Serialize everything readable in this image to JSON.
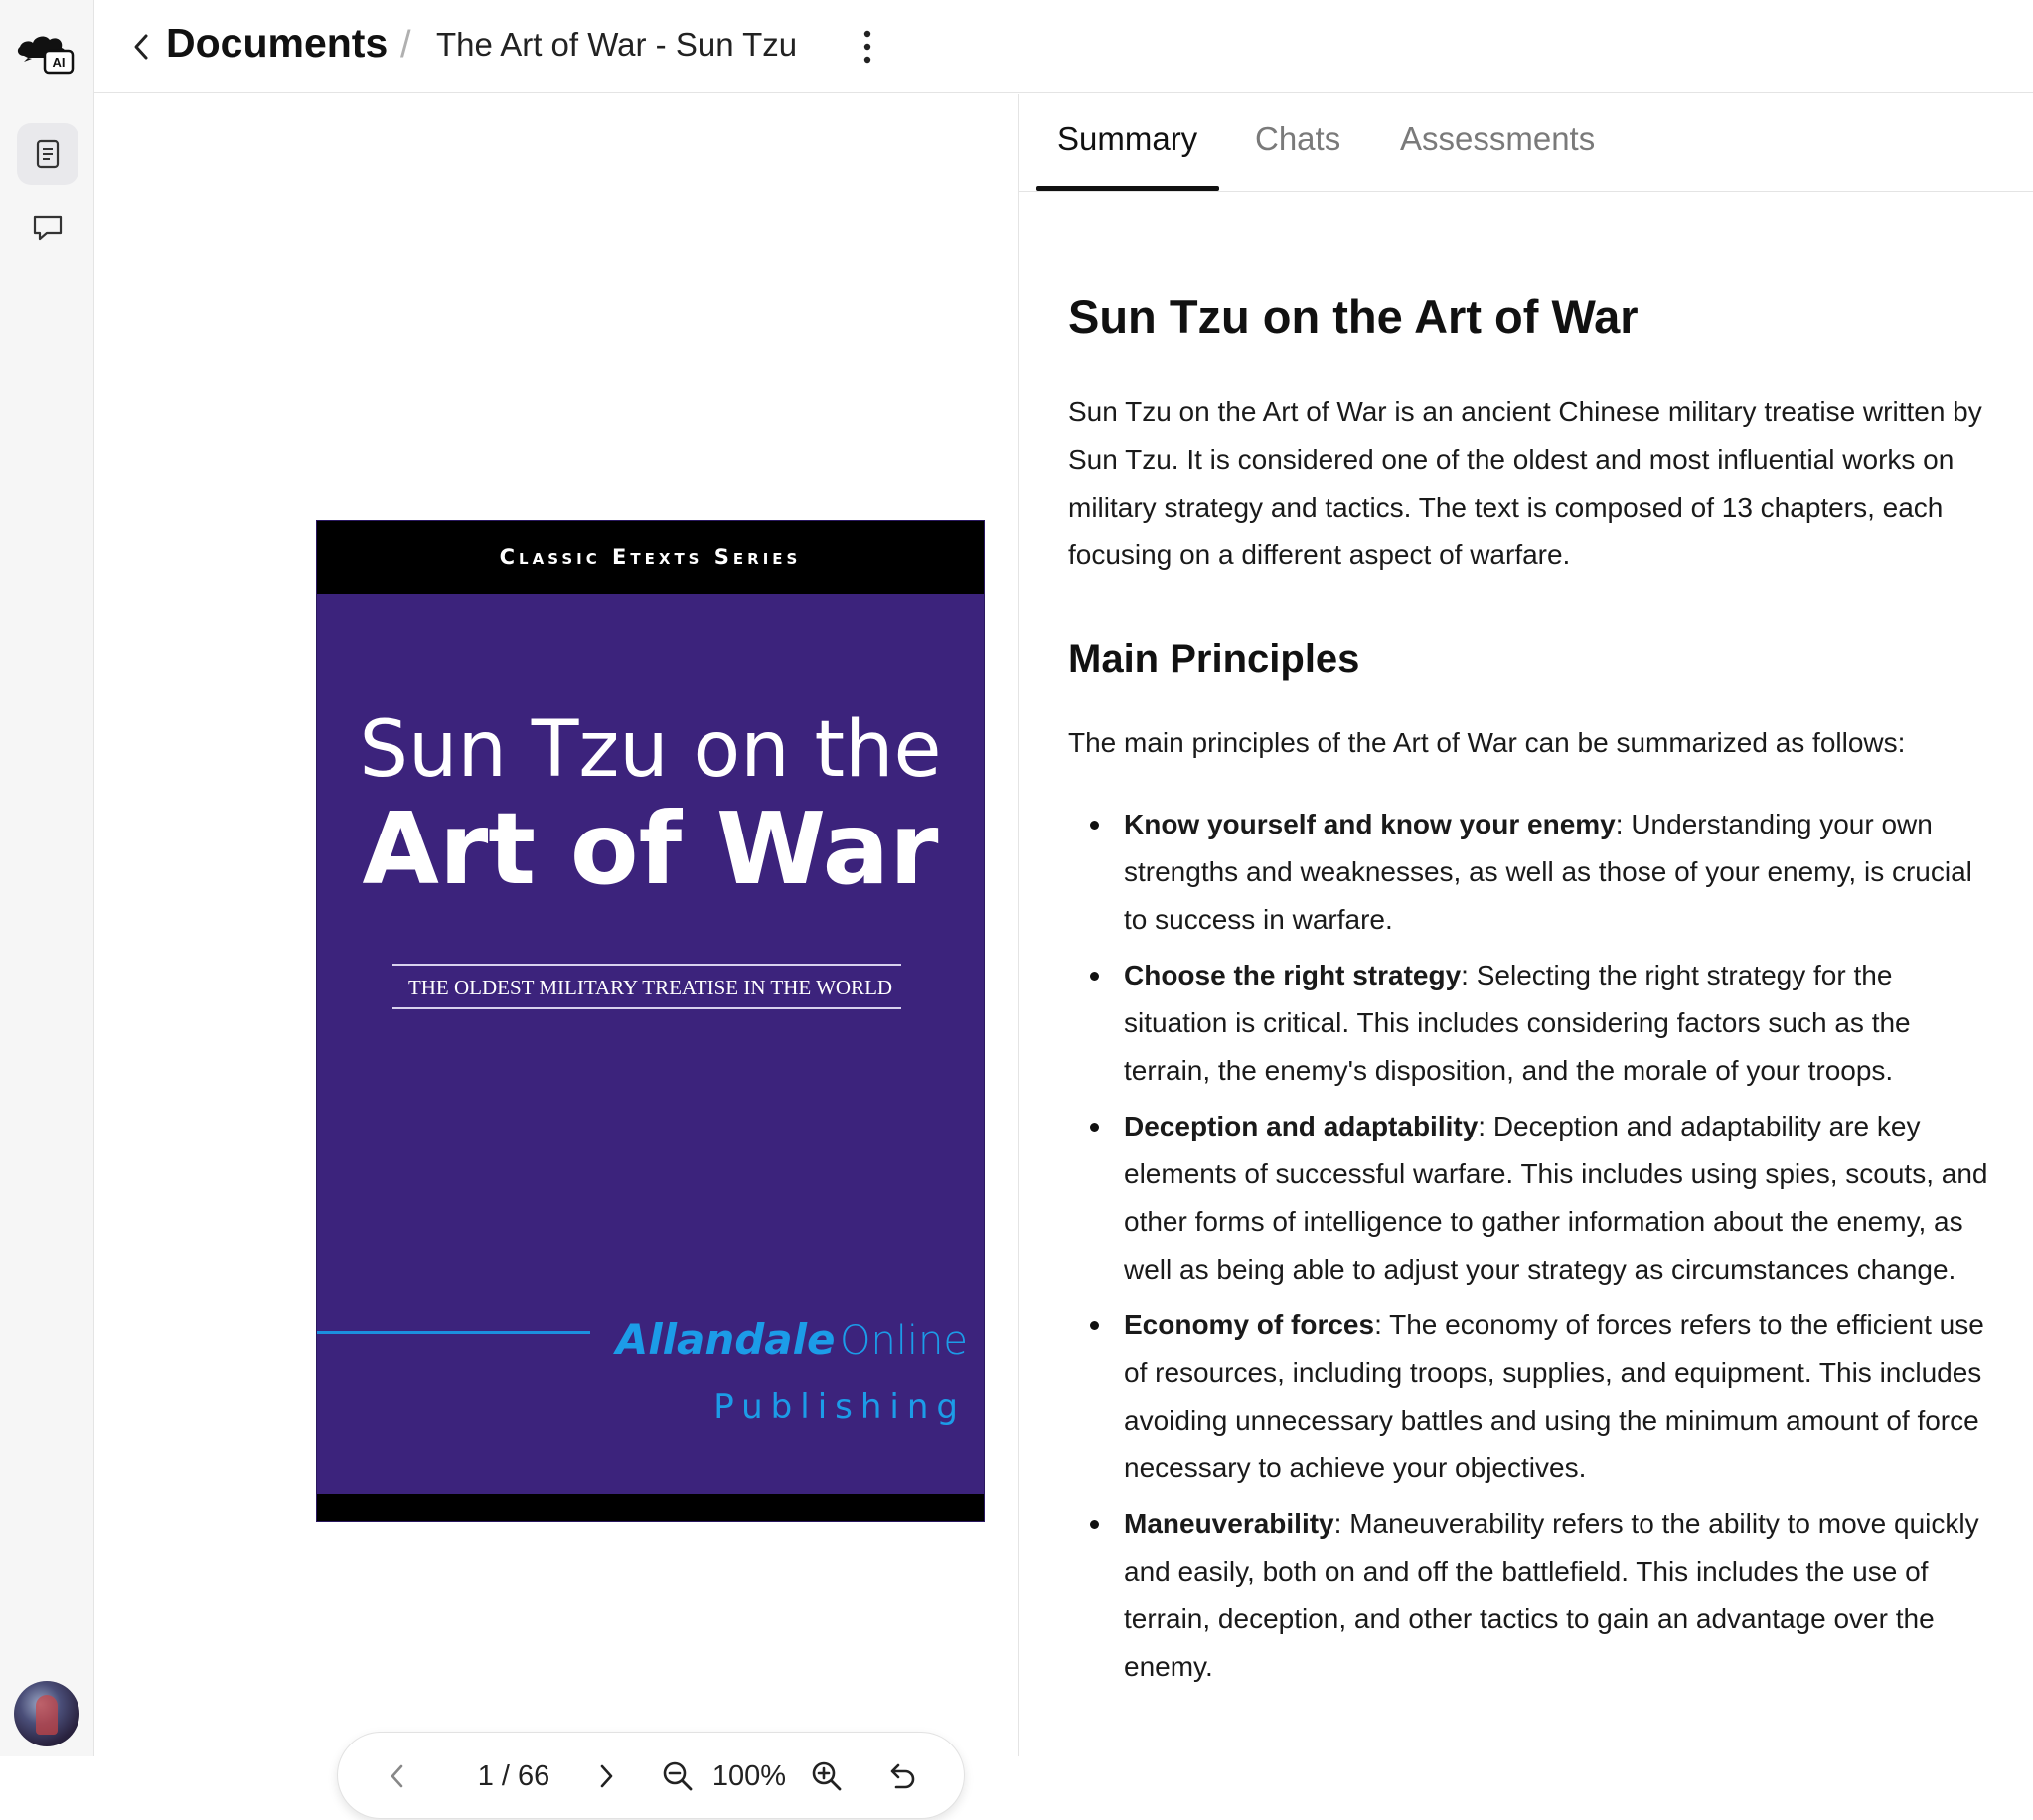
{
  "app": {
    "logo_badge": "AI"
  },
  "header": {
    "back_label": "Documents",
    "separator": "/",
    "document_title": "The Art of War - Sun Tzu"
  },
  "icons": {
    "logo": "cloud-ai-logo-icon",
    "documents": "document-icon",
    "chats": "chat-bubble-icon",
    "back": "chevron-left-icon",
    "more": "kebab-menu-icon",
    "prev": "chevron-left-icon",
    "next": "chevron-right-icon",
    "zoom_out": "zoom-out-icon",
    "zoom_in": "zoom-in-icon",
    "reset": "rotate-undo-icon"
  },
  "viewer": {
    "cover": {
      "series": "Classic Etexts Series",
      "title_line1": "Sun Tzu on the",
      "title_line2": "Art of War",
      "subtitle": "THE OLDEST MILITARY TREATISE IN THE WORLD",
      "publisher_part1": "Allandale",
      "publisher_part2": "Online",
      "publisher_line2": "Publishing"
    },
    "pager": {
      "current_page": "1",
      "page_total": "/ 66",
      "zoom": "100%"
    }
  },
  "panel": {
    "tabs": [
      {
        "label": "Summary",
        "active": true
      },
      {
        "label": "Chats",
        "active": false
      },
      {
        "label": "Assessments",
        "active": false
      }
    ],
    "summary": {
      "title": "Sun Tzu on the Art of War",
      "intro": "Sun Tzu on the Art of War is an ancient Chinese military treatise written by Sun Tzu. It is considered one of the oldest and most influential works on military strategy and tactics. The text is composed of 13 chapters, each focusing on a different aspect of warfare.",
      "section_title": "Main Principles",
      "section_intro": "The main principles of the Art of War can be summarized as follows:",
      "principles": [
        {
          "term": "Know yourself and know your enemy",
          "text": ": Understanding your own strengths and weaknesses, as well as those of your enemy, is crucial to success in warfare."
        },
        {
          "term": "Choose the right strategy",
          "text": ": Selecting the right strategy for the situation is critical. This includes considering factors such as the terrain, the enemy's disposition, and the morale of your troops."
        },
        {
          "term": "Deception and adaptability",
          "text": ": Deception and adaptability are key elements of successful warfare. This includes using spies, scouts, and other forms of intelligence to gather information about the enemy, as well as being able to adjust your strategy as circumstances change."
        },
        {
          "term": "Economy of forces",
          "text": ": The economy of forces refers to the efficient use of resources, including troops, supplies, and equipment. This includes avoiding unnecessary battles and using the minimum amount of force necessary to achieve your objectives."
        },
        {
          "term": "Maneuverability",
          "text": ": Maneuverability refers to the ability to move quickly and easily, both on and off the battlefield. This includes the use of terrain, deception, and other tactics to gain an advantage over the enemy."
        }
      ]
    }
  },
  "colors": {
    "cover_purple": "#3c237c",
    "publisher_blue": "#1c9ce8",
    "active_tab": "#111111",
    "inactive_tab": "#7a7a7a"
  }
}
